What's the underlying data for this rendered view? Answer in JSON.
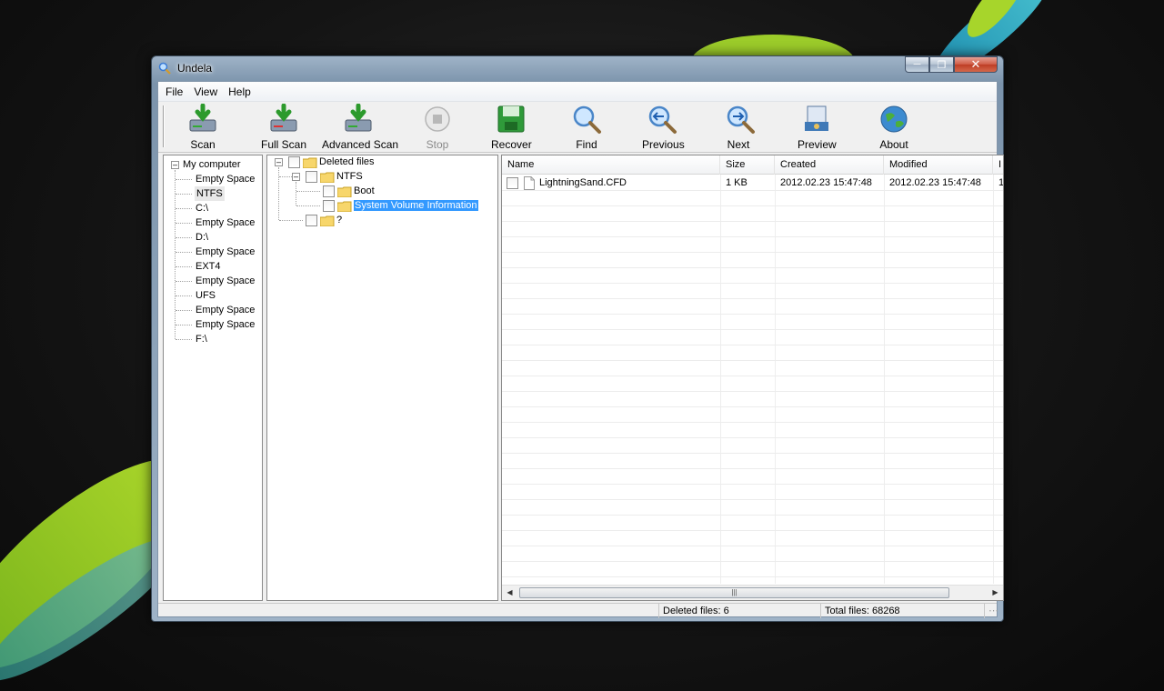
{
  "window": {
    "title": "Undela"
  },
  "menu": [
    "File",
    "View",
    "Help"
  ],
  "toolbar": {
    "scan": "Scan",
    "full_scan": "Full Scan",
    "advanced_scan": "Advanced Scan",
    "stop": "Stop",
    "recover": "Recover",
    "find": "Find",
    "previous": "Previous",
    "next": "Next",
    "preview": "Preview",
    "about": "About"
  },
  "drives": {
    "root": "My computer",
    "items": [
      "Empty Space",
      "NTFS",
      "C:\\",
      "Empty Space",
      "D:\\",
      "Empty Space",
      "EXT4",
      "Empty Space",
      "UFS",
      "Empty Space",
      "Empty Space",
      "F:\\"
    ],
    "highlighted_index": 1
  },
  "folders": {
    "root": "Deleted files",
    "ntfs": "NTFS",
    "boot": "Boot",
    "system_volume": "System Volume Information",
    "unknown": "?"
  },
  "filelist": {
    "columns": [
      "Name",
      "Size",
      "Created",
      "Modified",
      "I"
    ],
    "rows": [
      {
        "name": "LightningSand.CFD",
        "size": "1 KB",
        "created": "2012.02.23 15:47:48",
        "modified": "2012.02.23 15:47:48",
        "extra": "1"
      }
    ]
  },
  "status": {
    "deleted": "Deleted files: 6",
    "total": "Total files: 68268"
  },
  "colors": {
    "selection": "#3399ff",
    "accent_close": "#c9472d"
  }
}
